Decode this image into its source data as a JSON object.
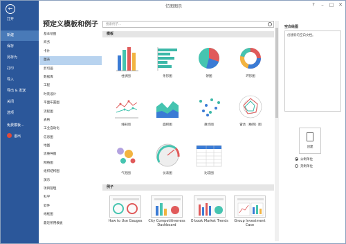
{
  "window": {
    "title": "亿图图示",
    "help": "?",
    "min": "–",
    "max": "□",
    "close": "✕"
  },
  "sidebar": {
    "back": "←",
    "items": [
      "打开",
      "新建",
      "保存",
      "另存为",
      "打印",
      "导入",
      "导出 & 发送",
      "关闭",
      "选项",
      "免费模板...",
      "退出"
    ],
    "active_index": 1
  },
  "heading": "预定义模板和例子",
  "categories": {
    "items": [
      "基本绘图",
      "商务",
      "卡片",
      "图表",
      "剪切画",
      "数据库",
      "工程",
      "时装设计",
      "平面布置图",
      "流程图",
      "表格",
      "工业自动化",
      "信息图",
      "地图",
      "思维导图",
      "网络图",
      "组织结构图",
      "演示",
      "项目管理",
      "科学",
      "软件",
      "线框图",
      "最近所用模板"
    ],
    "selected_index": 3
  },
  "search": {
    "placeholder": "搜索例子..."
  },
  "templates": {
    "section": "模板",
    "items": [
      "柱状图",
      "条形图",
      "饼图",
      "环形图",
      "线形图",
      "面积图",
      "散点图",
      "雷达（蛛网）图",
      "气泡图",
      "仪表图",
      "比较图"
    ]
  },
  "examples": {
    "section": "例子",
    "items": [
      "How to Use Gauges",
      "City Competitiveness Dashboard",
      "E-book Market Trends",
      "Group Investment Case"
    ]
  },
  "right_panel": {
    "title": "空白绘图",
    "description": "创建新的空白文档。",
    "create": "创建",
    "units": [
      "公制单位",
      "英制单位"
    ],
    "selected_unit": 0
  },
  "colors": {
    "sidebar": "#2b579a",
    "selected": "#b8d3ef",
    "accent": "#3a7bd5",
    "red": "#e05a5a",
    "teal": "#3cb8a8"
  }
}
